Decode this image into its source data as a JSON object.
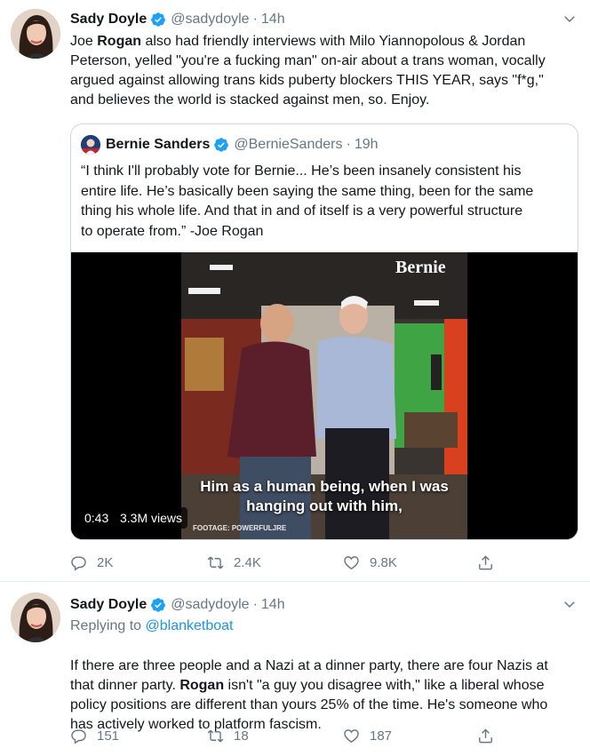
{
  "tweets": [
    {
      "name": "Sady Doyle",
      "handle": "@sadydoyle",
      "dot": "·",
      "time": "14h",
      "text_lines": [
        [
          "Joe ",
          "Rogan",
          " also had friendly interviews with Milo Yiannopolous & Jordan"
        ],
        [
          "Peterson, yelled \"you're a fucking man\" on-air about a trans woman, vocally"
        ],
        [
          "argued against allowing trans kids puberty blockers THIS YEAR, says \"f*g,\""
        ],
        [
          "and believes the world is stacked against men, so. Enjoy."
        ]
      ],
      "quote": {
        "name": "Bernie Sanders",
        "handle": "@BernieSanders",
        "dot": "·",
        "time": "19h",
        "lines": [
          "“I think I'll probably vote for Bernie... He’s been insanely consistent his",
          "entire life. He’s basically been saying the same thing, been for the same",
          "thing his whole life. And that in and of itself is a very powerful structure",
          "to operate from.” -Joe Rogan"
        ],
        "video": {
          "duration": "0:43",
          "views": "3.3M views",
          "caption_lines": [
            "Him as a human being, when I was",
            "hanging out with him,"
          ],
          "footage_credit": "FOOTAGE: POWERFULJRE",
          "logo": "Bernie"
        }
      },
      "actions": {
        "replies": "2K",
        "retweets": "2.4K",
        "likes": "9.8K"
      }
    },
    {
      "name": "Sady Doyle",
      "handle": "@sadydoyle",
      "dot": "·",
      "time": "14h",
      "replying_prefix": "Replying to ",
      "replying_handle": "@blanketboat",
      "text_lines": [
        [
          "If there are three people and a Nazi at a dinner party, there are four Nazis at"
        ],
        [
          "that dinner party. ",
          "Rogan",
          " isn't \"a guy you disagree with,\" like a liberal whose"
        ],
        [
          "policy positions are different than yours 25% of the time. He's someone who"
        ],
        [
          "has actively worked to platform fascism."
        ]
      ],
      "actions": {
        "replies": "151",
        "retweets": "18",
        "likes": "187"
      }
    }
  ],
  "colors": {
    "accent": "#1da1f2",
    "secondary_text": "#657786",
    "border": "#e6ecf0"
  },
  "icons": [
    "verified-badge-icon",
    "chevron-down-icon",
    "reply-icon",
    "retweet-icon",
    "like-icon",
    "share-icon"
  ]
}
